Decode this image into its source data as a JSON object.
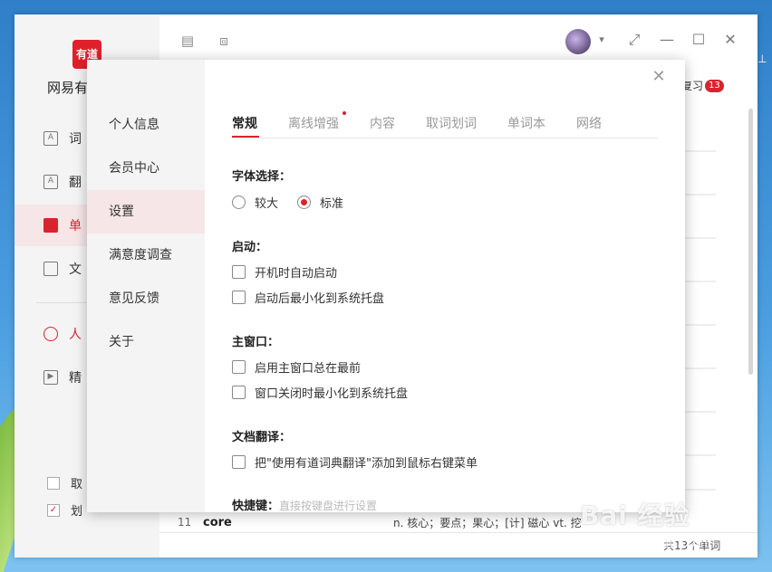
{
  "app": {
    "logo_text": "有道",
    "name": "网易有",
    "nav": [
      {
        "label": "词",
        "icon": "dictionary-icon"
      },
      {
        "label": "翻",
        "icon": "translate-icon"
      },
      {
        "label": "单",
        "icon": "wordbook-icon"
      },
      {
        "label": "文",
        "icon": "document-icon"
      },
      {
        "label": "人",
        "icon": "human-translate-icon"
      },
      {
        "label": "精",
        "icon": "video-course-icon"
      }
    ],
    "bottom_checks": [
      {
        "label": "取",
        "checked": false
      },
      {
        "label": "划",
        "checked": true
      }
    ],
    "review_label": "复习",
    "review_count": "13",
    "word_row": {
      "index": "11",
      "word": "core",
      "definition": "n. 核心；要点；果心；[计] 磁心  vt. 挖"
    },
    "footer_count": "共13个单词",
    "accent_color": "#d9232e"
  },
  "settings": {
    "side_nav": [
      "个人信息",
      "会员中心",
      "设置",
      "满意度调查",
      "意见反馈",
      "关于"
    ],
    "active_nav": "设置",
    "tabs": [
      "常规",
      "离线增强",
      "内容",
      "取词划词",
      "单词本",
      "网络"
    ],
    "active_tab": "常规",
    "font": {
      "title": "字体选择：",
      "options": [
        "较大",
        "标准"
      ],
      "selected": "标准"
    },
    "startup": {
      "title": "启动：",
      "options": [
        "开机时自动启动",
        "启动后最小化到系统托盘"
      ]
    },
    "main_window": {
      "title": "主窗口：",
      "options": [
        "启用主窗口总在最前",
        "窗口关闭时最小化到系统托盘"
      ]
    },
    "doc_translate": {
      "title": "文档翻译：",
      "options": [
        "把\"使用有道词典翻译\"添加到鼠标右键菜单"
      ]
    },
    "shortcut": {
      "title": "快捷键：",
      "hint": "直接按键盘进行设置"
    }
  },
  "watermark": {
    "main": "Bai 经验",
    "sub": "jingyan.baidu.com"
  }
}
